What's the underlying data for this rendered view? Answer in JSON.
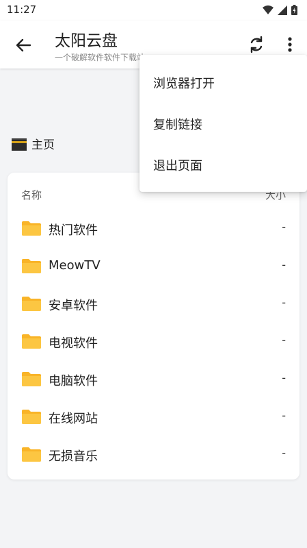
{
  "status_bar": {
    "time": "11:27"
  },
  "app_bar": {
    "title": "太阳云盘",
    "subtitle": "一个破解软件软件下载站"
  },
  "breadcrumb": {
    "label": "主页"
  },
  "file_list": {
    "header": {
      "name": "名称",
      "size": "大小"
    },
    "items": [
      {
        "name": "热门软件",
        "size": "-"
      },
      {
        "name": "MeowTV",
        "size": "-"
      },
      {
        "name": "安卓软件",
        "size": "-"
      },
      {
        "name": "电视软件",
        "size": "-"
      },
      {
        "name": "电脑软件",
        "size": "-"
      },
      {
        "name": "在线网站",
        "size": "-"
      },
      {
        "name": "无损音乐",
        "size": "-"
      }
    ]
  },
  "overflow_menu": {
    "items": [
      {
        "label": "浏览器打开"
      },
      {
        "label": "复制链接"
      },
      {
        "label": "退出页面"
      }
    ]
  },
  "colors": {
    "folder": "#fbbf24",
    "background": "#f3f4f6"
  },
  "icons": [
    "back-arrow-icon",
    "refresh-icon",
    "more-vert-icon",
    "kaaba-icon",
    "folder-icon",
    "wifi-icon",
    "signal-icon",
    "battery-icon"
  ]
}
